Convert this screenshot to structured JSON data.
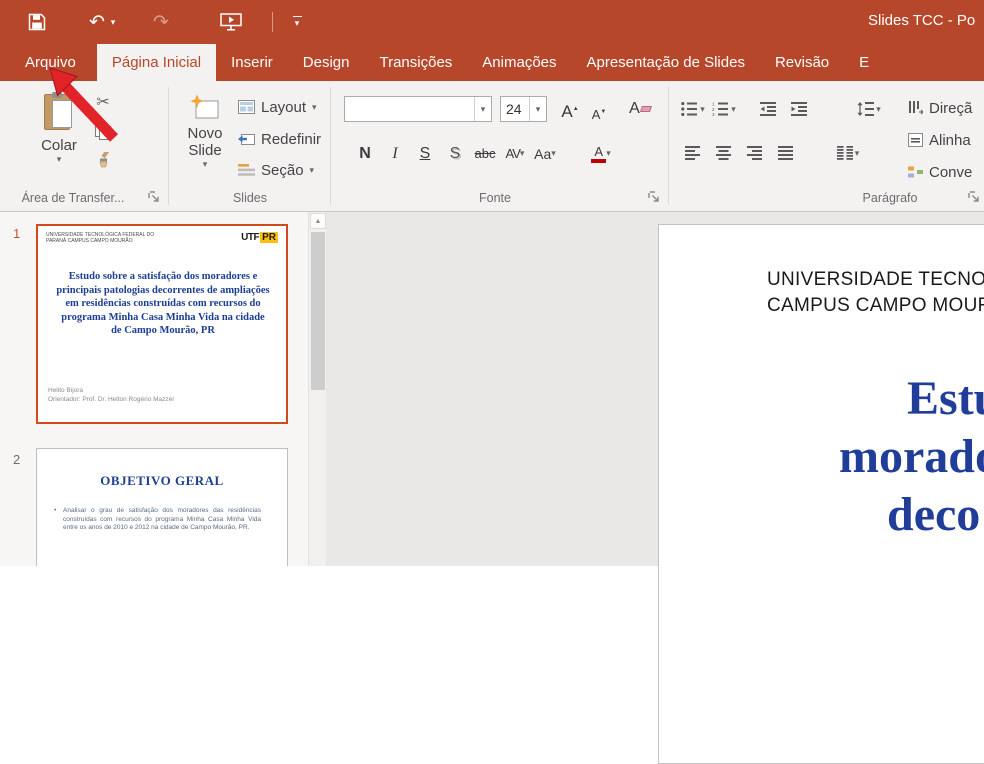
{
  "app": {
    "title": "Slides TCC - Po"
  },
  "colors": {
    "accent": "#b7472a",
    "selected_slide_border": "#d04a1e",
    "slide_title_blue": "#1c3f94",
    "annotation_arrow_red": "#e2232a"
  },
  "icons": {
    "scissors": "✂",
    "undo": "↶",
    "redo": "↷",
    "dropdown": "▾",
    "up_caret": "▲",
    "down_caret": "▼",
    "scroll_up": "▲"
  },
  "tabs": [
    {
      "label": "Arquivo",
      "selected": false
    },
    {
      "label": "Página Inicial",
      "selected": true
    },
    {
      "label": "Inserir",
      "selected": false
    },
    {
      "label": "Design",
      "selected": false
    },
    {
      "label": "Transições",
      "selected": false
    },
    {
      "label": "Animações",
      "selected": false
    },
    {
      "label": "Apresentação de Slides",
      "selected": false
    },
    {
      "label": "Revisão",
      "selected": false
    },
    {
      "label": "E",
      "selected": false
    }
  ],
  "ribbon": {
    "clipboard": {
      "paste_label": "Colar",
      "group_label": "Área de Transfer..."
    },
    "slides_group": {
      "new_slide_line1": "Novo",
      "new_slide_line2": "Slide",
      "layout_label": "Layout",
      "reset_label": "Redefinir",
      "section_label": "Seção",
      "group_label": "Slides"
    },
    "font_group": {
      "font_name_value": "",
      "font_size_value": "24",
      "grow_font": "A",
      "shrink_font": "A",
      "clear_format": "A",
      "bold": "N",
      "italic": "I",
      "underline": "S",
      "shadow": "S",
      "strikethrough": "abc",
      "char_spacing": "AV",
      "change_case": "Aa",
      "font_color": "A",
      "group_label": "Fonte"
    },
    "paragraph_group": {
      "text_direction_label": "Direçã",
      "align_text_label": "Alinha",
      "convert_smartart_label": "Conve",
      "group_label": "Parágrafo"
    }
  },
  "panel": {
    "slides": [
      {
        "number": "1",
        "header": "UNIVERSIDADE TECNOLÓGICA FEDERAL DO PARANÁ CAMPUS CAMPO MOURÃO",
        "logo_utf": "UTF",
        "logo_pr": "PR",
        "title": "Estudo sobre a satisfação dos moradores e principais patologias decorrentes de ampliações em residências construídas com recursos do programa Minha Casa Minha Vida na cidade de Campo Mourão, PR",
        "author": "Helito Bijora",
        "advisor": "Orientador: Prof. Dr. Helton Rogério Mazzer"
      },
      {
        "number": "2",
        "title": "OBJETIVO GERAL",
        "bullet_marker": "•",
        "bullet": "Analisar o grau de satisfação dos moradores das residências construídas com recursos do programa Minha Casa Minha Vida entre os anos de 2010 e 2012 na cidade de Campo Mourão, PR."
      }
    ]
  },
  "canvas": {
    "line1": "UNIVERSIDADE TECNO",
    "line2": "CAMPUS CAMPO MOUR",
    "big_lines": [
      "Estu",
      "morador",
      "deco"
    ]
  }
}
